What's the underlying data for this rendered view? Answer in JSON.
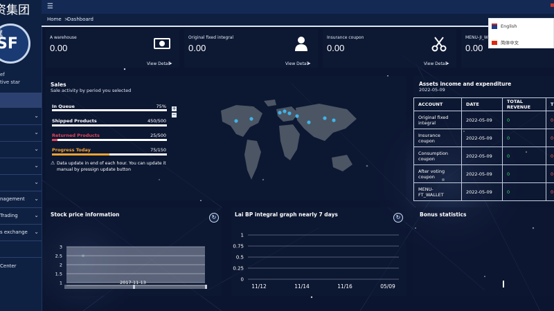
{
  "brand": {
    "name_fragment": "资集团",
    "logo_text": "SF"
  },
  "user": {
    "name_fragment": "ef",
    "role_fragment": "tive star"
  },
  "sidebar": {
    "items": [
      {
        "label": ""
      },
      {
        "label": ""
      },
      {
        "label": ""
      },
      {
        "label": ""
      },
      {
        "label": "nagement"
      },
      {
        "label": " Trading"
      },
      {
        "label": "s exchange"
      },
      {
        "label": ""
      },
      {
        "label": " Center"
      }
    ]
  },
  "breadcrumb": {
    "home": "Home",
    "sep": ">",
    "current": "Dashboard"
  },
  "stats": [
    {
      "label": "A warehouse",
      "value": "0.00",
      "icon": "money-icon",
      "detail": "View Detail"
    },
    {
      "label": "Original fixed integral",
      "value": "0.00",
      "icon": "user-icon",
      "detail": "View Detail"
    },
    {
      "label": "Insurance coupon",
      "value": "0.00",
      "icon": "scissors-icon",
      "detail": "View Detail"
    },
    {
      "label": "MENU-JI_W",
      "value": "0.00",
      "icon": "",
      "detail": ""
    }
  ],
  "language_menu": {
    "items": [
      {
        "label": "English",
        "flag": "uk-flag-icon"
      },
      {
        "label": "简体中文",
        "flag": "cn-flag-icon"
      }
    ]
  },
  "sales": {
    "title": "Sales",
    "subtitle": "Sale activity by period you selected",
    "progress": [
      {
        "label": "In Queue",
        "value": "75%",
        "fraction": 0.75,
        "color": "#ffffff",
        "fill": "#ffffff"
      },
      {
        "label": "Shipped Products",
        "value": "450/500",
        "fraction": 0.9,
        "color": "#ffffff",
        "fill": "#ffffff"
      },
      {
        "label": "Returned Products",
        "value": "25/500",
        "fraction": 0.05,
        "color": "#e0475a",
        "fill": "#e0475a"
      },
      {
        "label": "Progress Today",
        "value": "75/150",
        "fraction": 0.5,
        "color": "#f3a531",
        "fill": "#f3a531"
      }
    ],
    "note": "Data update in end of each hour. You can update it manual by pressign update button",
    "plus": "+",
    "minus": "−"
  },
  "assets": {
    "title": "Assets income and expenditure",
    "date": "2022-05-09",
    "headers": [
      "ACCOUNT",
      "DATE",
      "TOTAL REVENUE",
      "T"
    ],
    "rows": [
      {
        "account": "Original fixed integral",
        "date": "2022-05-09",
        "revenue": "0",
        "t": "0"
      },
      {
        "account": "Insurance coupon",
        "date": "2022-05-09",
        "revenue": "0",
        "t": "0"
      },
      {
        "account": "Consumption coupon",
        "date": "2022-05-09",
        "revenue": "0",
        "t": "0"
      },
      {
        "account": "After voting coupon",
        "date": "2022-05-09",
        "revenue": "0",
        "t": "0"
      },
      {
        "account": "MENU-FT_WALLET",
        "date": "2022-05-09",
        "revenue": "0",
        "t": "0"
      }
    ]
  },
  "stock": {
    "title": "Stock price information",
    "date_label": "2017-11-13"
  },
  "lai": {
    "title": "Lai BP integral graph nearly 7 days"
  },
  "bonus": {
    "title": "Bonus statistics"
  },
  "chart_data": [
    {
      "type": "area",
      "title": "Stock price information",
      "y_ticks": [
        "3",
        "2.5",
        "2",
        "1.5",
        "1"
      ],
      "ylim": [
        1,
        3
      ],
      "x_ticks": [
        "2017-11-13"
      ],
      "grid": true
    },
    {
      "type": "line",
      "title": "Lai BP integral graph nearly 7 days",
      "y_ticks": [
        "1",
        "0.75",
        "0.5",
        "0.25",
        "0"
      ],
      "ylim": [
        0,
        1
      ],
      "x_ticks": [
        "11/12",
        "11/14",
        "11/16",
        "05/09"
      ],
      "grid": true
    }
  ]
}
